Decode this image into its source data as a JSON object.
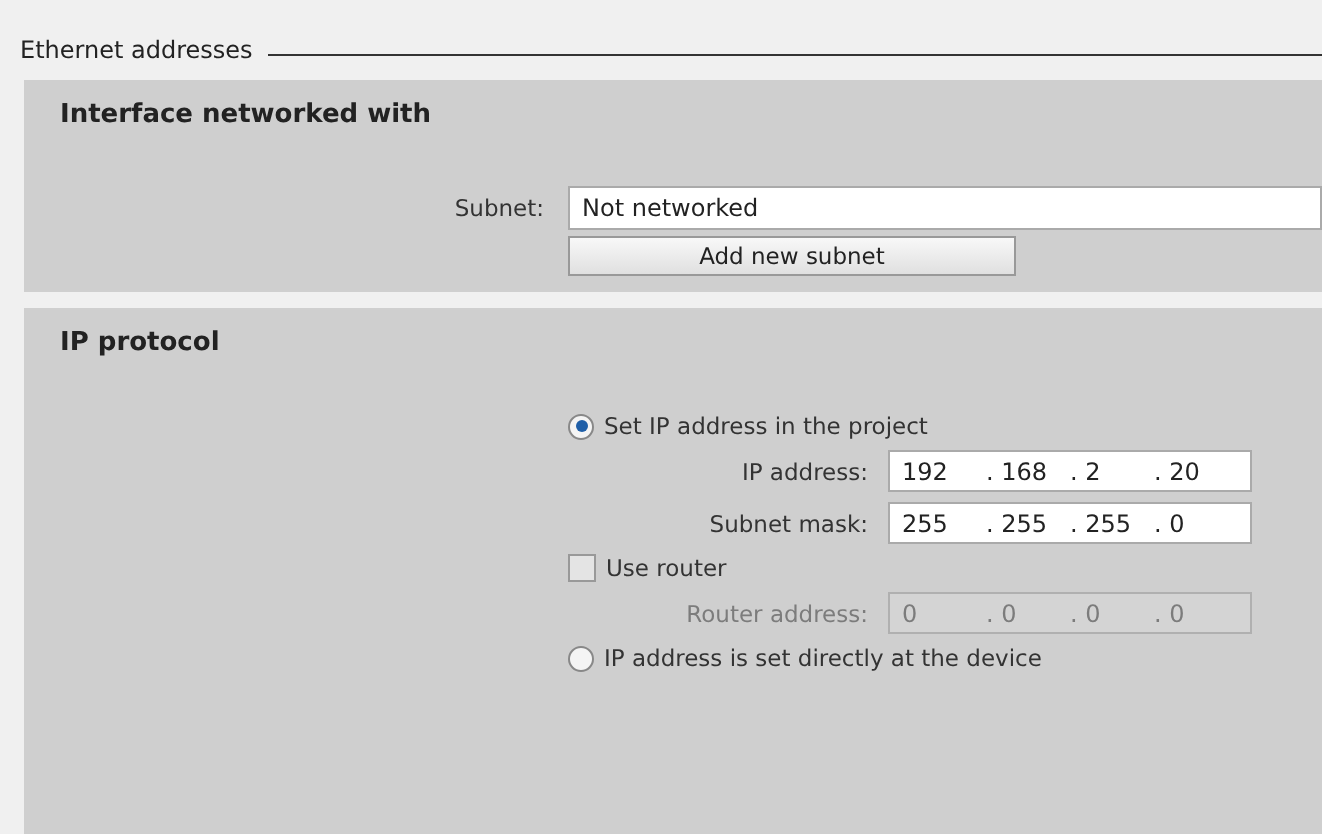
{
  "section_title": "Ethernet addresses",
  "interface_panel": {
    "title": "Interface networked with",
    "subnet": {
      "label": "Subnet:",
      "value": "Not networked"
    },
    "add_button": "Add new subnet"
  },
  "ip_panel": {
    "title": "IP protocol",
    "options": [
      {
        "kind": "radio",
        "label": "Set IP address in the project",
        "selected": true
      },
      {
        "kind": "field",
        "label": "IP address:",
        "octets": [
          "192",
          "168",
          "2",
          "20"
        ],
        "disabled": false
      },
      {
        "kind": "field",
        "label": "Subnet mask:",
        "octets": [
          "255",
          "255",
          "255",
          "0"
        ],
        "disabled": false
      },
      {
        "kind": "checkbox",
        "label": "Use router",
        "checked": false
      },
      {
        "kind": "field",
        "label": "Router address:",
        "octets": [
          "0",
          "0",
          "0",
          "0"
        ],
        "disabled": true
      },
      {
        "kind": "radio",
        "label": "IP address is set directly at the device",
        "selected": false
      }
    ],
    "separator": "."
  }
}
